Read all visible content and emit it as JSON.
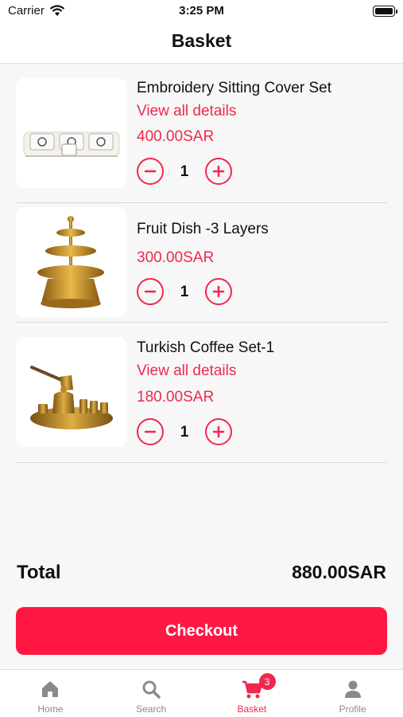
{
  "status": {
    "carrier": "Carrier",
    "time": "3:25 PM"
  },
  "header": {
    "title": "Basket"
  },
  "items": [
    {
      "title": "Embroidery Sitting Cover Set",
      "details_link": "View all details",
      "price": "400.00SAR",
      "quantity": "1"
    },
    {
      "title": "Fruit Dish -3 Layers",
      "details_link": "",
      "price": "300.00SAR",
      "quantity": "1"
    },
    {
      "title": "Turkish Coffee Set-1",
      "details_link": "View all details",
      "price": "180.00SAR",
      "quantity": "1"
    }
  ],
  "summary": {
    "total_label": "Total",
    "total_value": "880.00SAR"
  },
  "checkout_label": "Checkout",
  "tabbar": {
    "items": [
      {
        "label": "Home",
        "icon": "home-icon"
      },
      {
        "label": "Search",
        "icon": "search-icon"
      },
      {
        "label": "Basket",
        "icon": "cart-icon",
        "badge": "3"
      },
      {
        "label": "Profile",
        "icon": "person-icon"
      }
    ],
    "active": "Basket"
  },
  "colors": {
    "accent": "#f0294c",
    "checkout": "#ff1744",
    "background": "#f7f7f7"
  }
}
